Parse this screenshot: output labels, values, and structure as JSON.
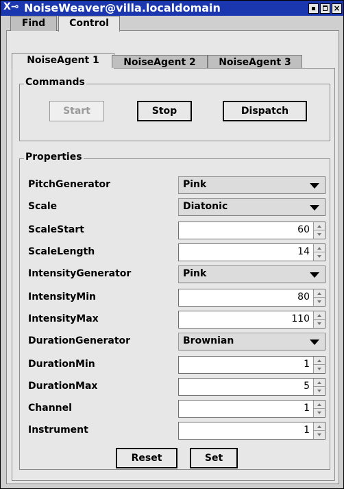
{
  "window": {
    "title": "NoiseWeaver@villa.localdomain",
    "icon_glyph": "X",
    "buttons": [
      "minimize-icon",
      "maximize-icon",
      "close-icon"
    ],
    "title_bg": "#1a37b0"
  },
  "outer_tabs": [
    {
      "label": "Find",
      "active": false
    },
    {
      "label": "Control",
      "active": true
    }
  ],
  "agent_tabs": [
    {
      "label": "NoiseAgent 1",
      "active": true
    },
    {
      "label": "NoiseAgent 2",
      "active": false
    },
    {
      "label": "NoiseAgent 3",
      "active": false
    }
  ],
  "commands": {
    "title": "Commands",
    "start": "Start",
    "stop": "Stop",
    "dispatch": "Dispatch"
  },
  "properties": {
    "title": "Properties",
    "rows": [
      {
        "label": "PitchGenerator",
        "type": "combo",
        "value": "Pink"
      },
      {
        "label": "Scale",
        "type": "combo",
        "value": "Diatonic"
      },
      {
        "label": "ScaleStart",
        "type": "spinner",
        "value": "60"
      },
      {
        "label": "ScaleLength",
        "type": "spinner",
        "value": "14"
      },
      {
        "label": "IntensityGenerator",
        "type": "combo",
        "value": "Pink"
      },
      {
        "label": "IntensityMin",
        "type": "spinner",
        "value": "80"
      },
      {
        "label": "IntensityMax",
        "type": "spinner",
        "value": "110"
      },
      {
        "label": "DurationGenerator",
        "type": "combo",
        "value": "Brownian"
      },
      {
        "label": "DurationMin",
        "type": "spinner",
        "value": "1"
      },
      {
        "label": "DurationMax",
        "type": "spinner",
        "value": "5"
      },
      {
        "label": "Channel",
        "type": "spinner",
        "value": "1"
      },
      {
        "label": "Instrument",
        "type": "spinner",
        "value": "1"
      }
    ]
  },
  "footer": {
    "reset": "Reset",
    "set": "Set"
  }
}
